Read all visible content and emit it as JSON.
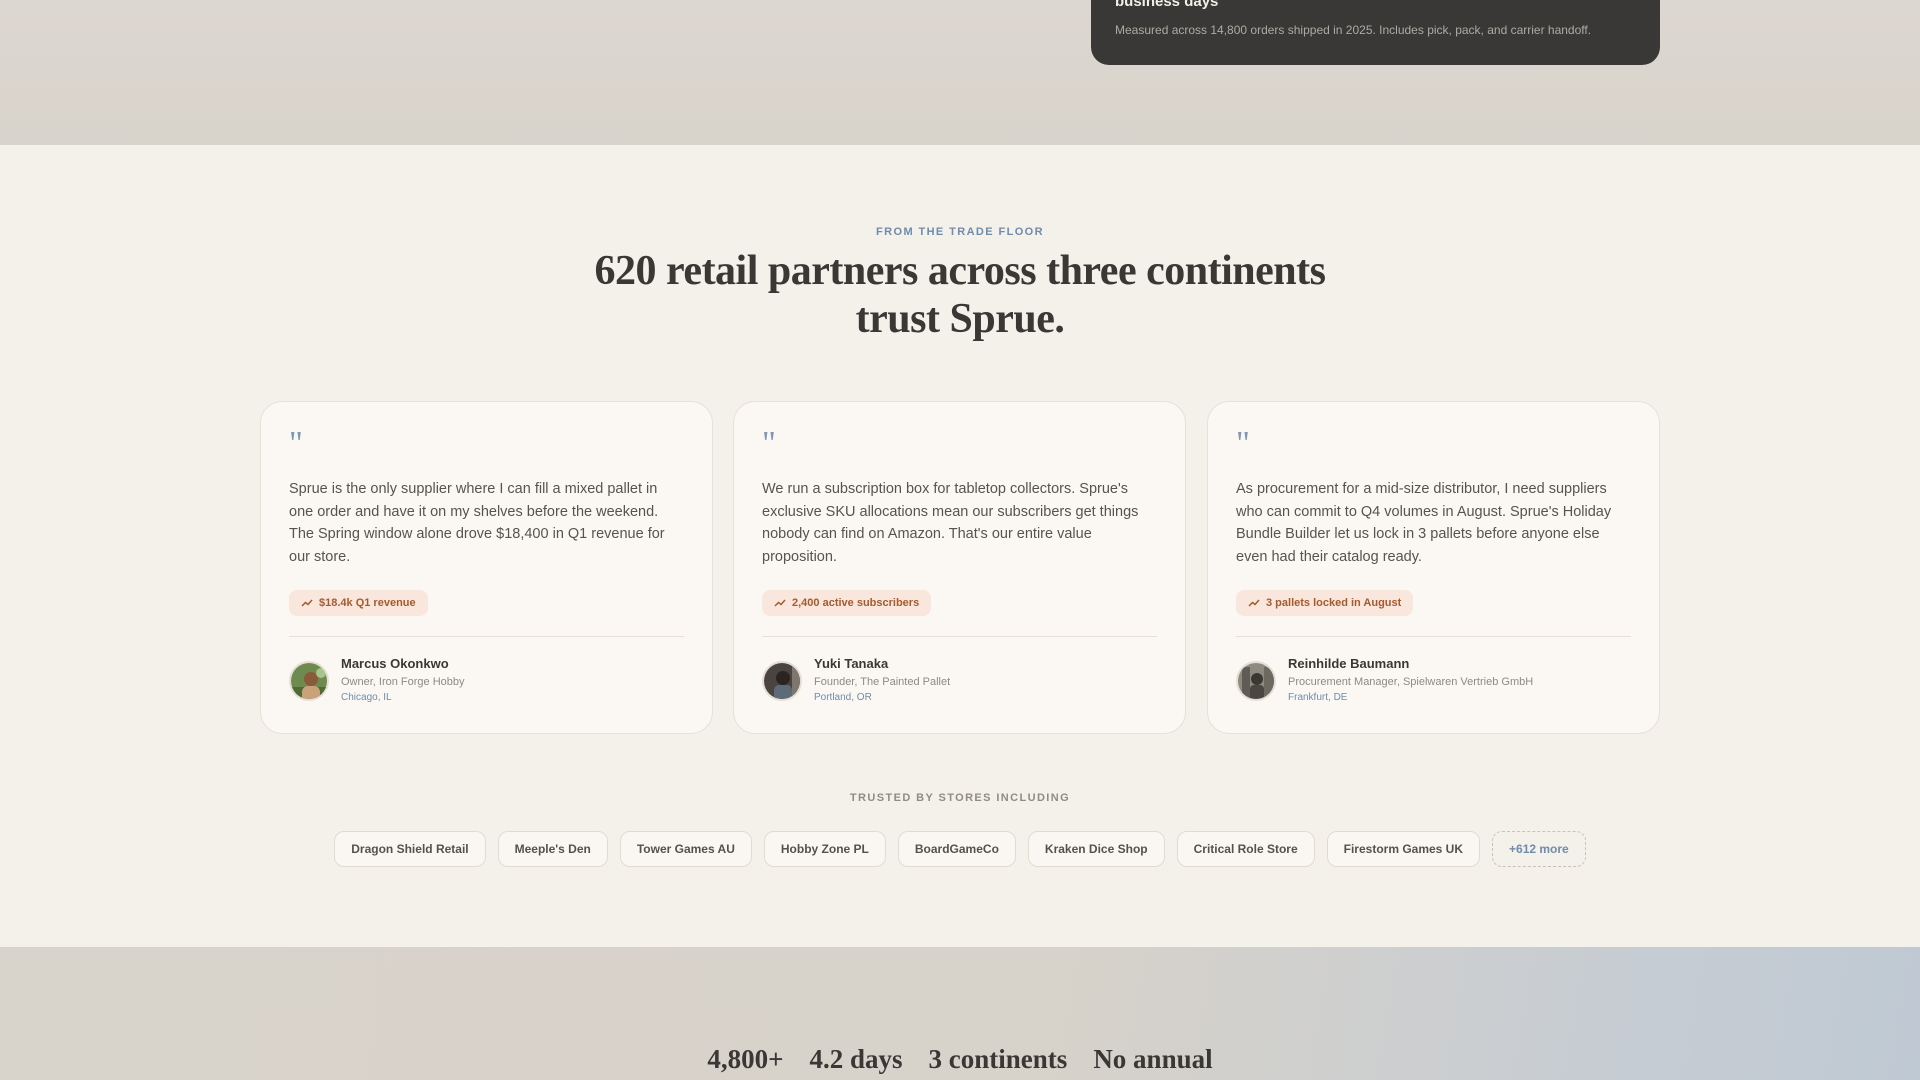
{
  "top_card": {
    "title": "business days",
    "note": "Measured across 14,800 orders shipped in 2025. Includes pick, pack, and carrier handoff."
  },
  "section": {
    "eyebrow": "FROM THE TRADE FLOOR",
    "headline": "620 retail partners across three continents trust Sprue."
  },
  "testimonials": [
    {
      "quote": "Sprue is the only supplier where I can fill a mixed pallet in one order and have it on my shelves before the weekend. The Spring window alone drove $18,400 in Q1 revenue for our store.",
      "metric": "$18.4k Q1 revenue",
      "name": "Marcus Okonkwo",
      "role": "Owner, Iron Forge Hobby",
      "location": "Chicago, IL"
    },
    {
      "quote": "We run a subscription box for tabletop collectors. Sprue's exclusive SKU allocations mean our subscribers get things nobody can find on Amazon. That's our entire value proposition.",
      "metric": "2,400 active subscribers",
      "name": "Yuki Tanaka",
      "role": "Founder, The Painted Pallet",
      "location": "Portland, OR"
    },
    {
      "quote": "As procurement for a mid-size distributor, I need suppliers who can commit to Q4 volumes in August. Sprue's Holiday Bundle Builder let us lock in 3 pallets before anyone else even had their catalog ready.",
      "metric": "3 pallets locked in August",
      "name": "Reinhilde Baumann",
      "role": "Procurement Manager, Spielwaren Vertrieb GmbH",
      "location": "Frankfurt, DE"
    }
  ],
  "trusted": {
    "label": "TRUSTED BY STORES INCLUDING",
    "stores": [
      "Dragon Shield Retail",
      "Meeple's Den",
      "Tower Games AU",
      "Hobby Zone PL",
      "BoardGameCo",
      "Kraken Dice Shop",
      "Critical Role Store",
      "Firestorm Games UK"
    ],
    "more": "+612 more"
  },
  "stats": [
    "4,800+",
    "4.2 days",
    "3 continents",
    "No annual"
  ],
  "icons": {
    "quote": "quote-icon",
    "metric": "trend-up-icon"
  },
  "colors": {
    "accent_blue": "#6f8cab",
    "metric_bg": "#f9e6dc",
    "metric_text": "#a65a2e",
    "dark_card": "#3a3836"
  }
}
